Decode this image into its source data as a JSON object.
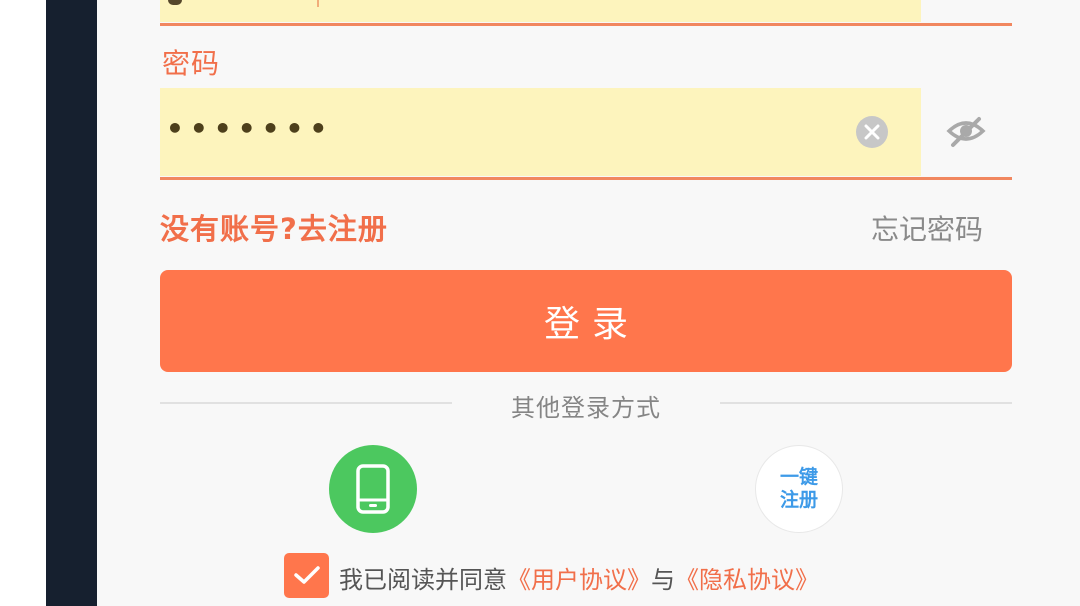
{
  "theme": {
    "accent": "#ff764c",
    "accent_text": "#f16f4a",
    "field_bg": "#fdf4bd",
    "phone_green": "#4cc85f",
    "register_blue": "#3d9ae8",
    "frame_dark": "#16202f"
  },
  "password": {
    "label": "密码",
    "masked_value": "•••••••",
    "clear_icon": "clear-circle-x-icon",
    "toggle_icon": "eye-slash-icon"
  },
  "links": {
    "register": "没有账号?去注册",
    "forgot": "忘记密码"
  },
  "login_button": {
    "label": "登录"
  },
  "other_login": {
    "divider_text": "其他登录方式",
    "phone_icon": "mobile-phone-icon",
    "onekey_line1": "一键",
    "onekey_line2": "注册"
  },
  "agreement": {
    "checked": true,
    "prefix": "我已阅读并同意",
    "user_agreement": "《用户协议》",
    "conjunction": "与",
    "privacy_policy": "《隐私协议》"
  }
}
